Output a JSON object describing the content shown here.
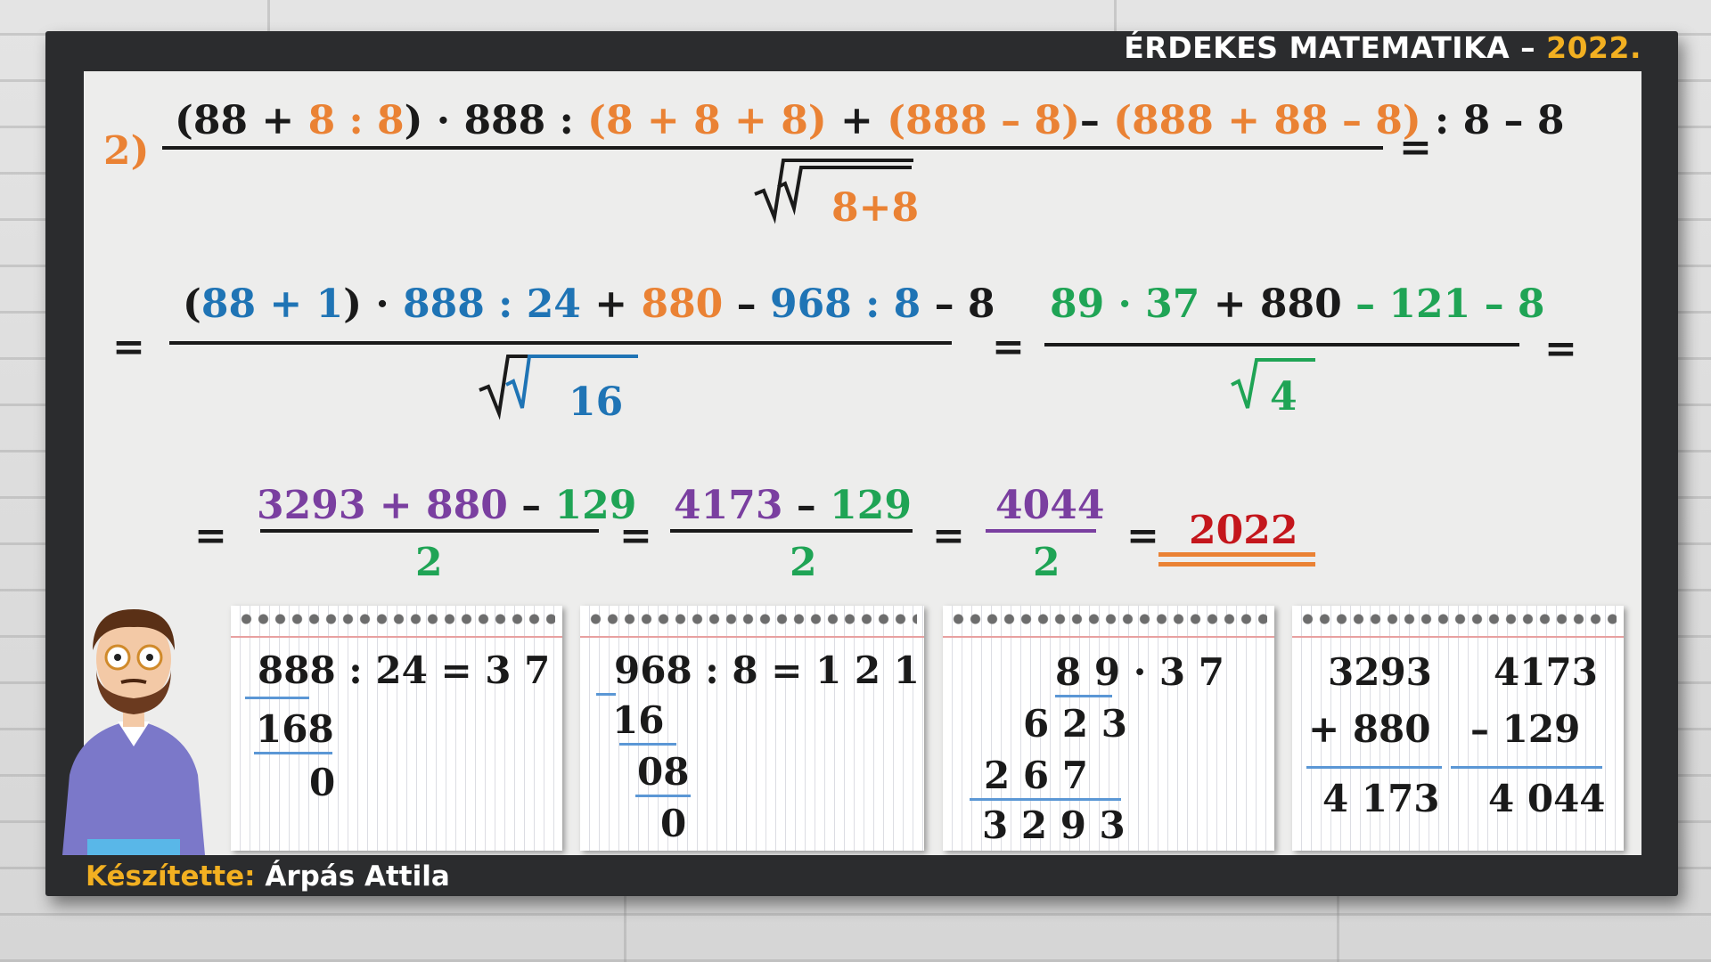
{
  "header": {
    "title": "ÉRDEKES MATEMATIKA –",
    "year": "2022."
  },
  "footer": {
    "label": "Készítette:",
    "author": "Árpás Attila"
  },
  "problem_number": "2)",
  "row1": {
    "num": [
      "(88 + ",
      "8 : 8",
      ") · 888 : ",
      "(8 + 8 + 8)",
      " + ",
      "(888 – 8)",
      "– ",
      "(888 + 88 – 8)",
      " : 8 – 8"
    ],
    "den": "8+8",
    "eq": "="
  },
  "row2": {
    "eq": "=",
    "num_a": [
      "(",
      "88 + 1",
      ") · ",
      "888 : 24",
      " + ",
      "880",
      " – ",
      "968 : 8",
      " – 8"
    ],
    "den_a": "16",
    "num_b": [
      "89 · 37",
      " + 880",
      " – 121 – 8"
    ],
    "den_b": "4"
  },
  "row3": {
    "eq": "=",
    "f1": {
      "num": [
        "3293",
        " + 880",
        " – ",
        "129"
      ],
      "den": "2"
    },
    "f2": {
      "num": [
        "4173",
        " – ",
        "129"
      ],
      "den": "2"
    },
    "f3": {
      "num": "4044",
      "den": "2"
    },
    "result": "2022"
  },
  "pads": [
    {
      "lines": [
        "888 : 24 = 3 7",
        "168",
        "0"
      ]
    },
    {
      "lines": [
        "968 : 8 =  1 2 1",
        "16",
        "08",
        "0"
      ]
    },
    {
      "lines": [
        "8 9 · 3 7",
        "6 2 3",
        "2 6 7",
        "3 2 9 3"
      ]
    },
    {
      "lines": [
        "3293",
        "+ 880",
        "4 173",
        "4173",
        "– 129",
        "4 044"
      ]
    }
  ],
  "colors": {
    "orange": "#ea8234",
    "blue": "#1f74b5",
    "green": "#1fa455",
    "purple": "#7a3fa0",
    "red": "#c4161c",
    "accent": "#f2b021"
  }
}
